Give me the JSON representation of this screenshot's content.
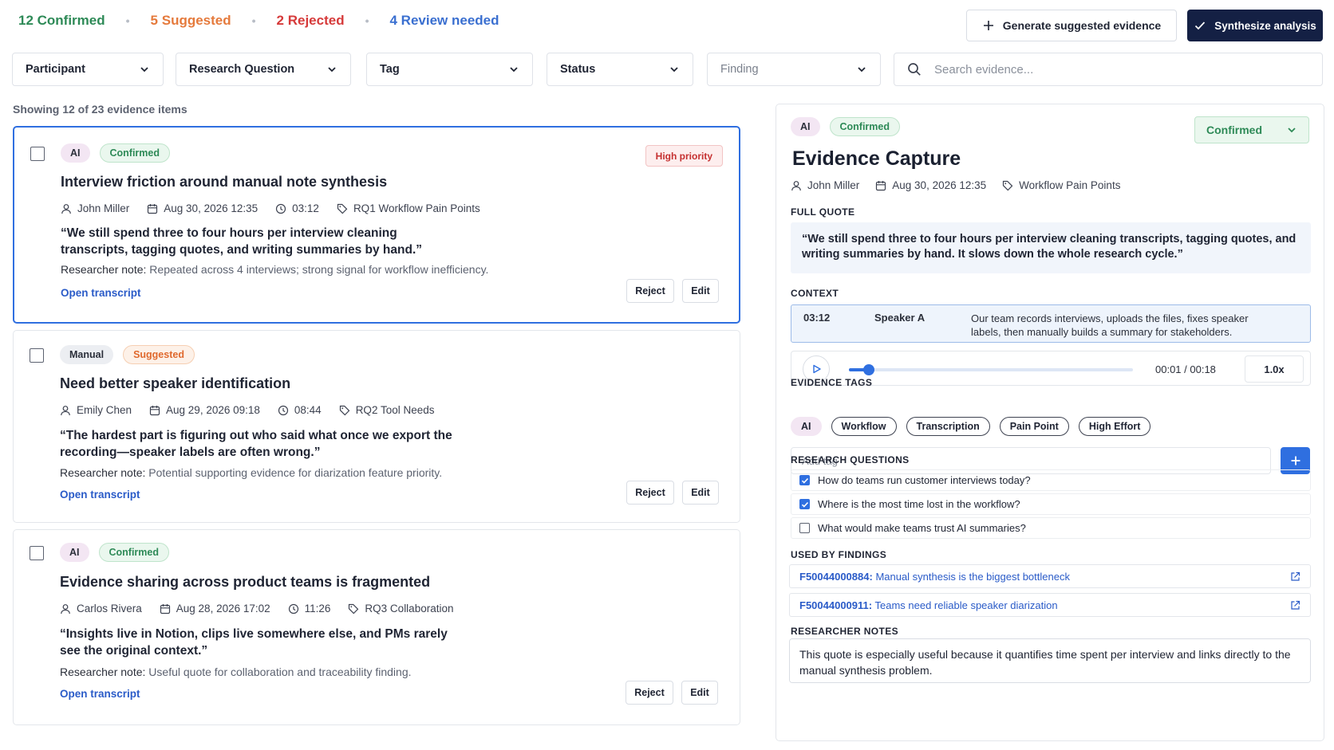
{
  "stats": {
    "confirmed": "12 Confirmed",
    "suggested": "5 Suggested",
    "rejected": "2 Rejected",
    "review": "4 Review needed"
  },
  "actions": {
    "generate": "Generate suggested evidence",
    "synthesize": "Synthesize analysis"
  },
  "filters": {
    "participant": "Participant",
    "research_question": "Research Question",
    "tag": "Tag",
    "status": "Status",
    "finding": "Finding",
    "search_placeholder": "Search evidence..."
  },
  "showing": "Showing 12 of 23 evidence items",
  "cards": [
    {
      "source": "AI",
      "status": "Confirmed",
      "priority": "High priority",
      "title": "Interview friction around manual note synthesis",
      "participant": "John Miller",
      "date": "Aug 30, 2026 12:35",
      "time": "03:12",
      "tag": "RQ1 Workflow Pain Points",
      "quote": "“We still spend three to four hours per interview cleaning transcripts, tagging quotes, and writing summaries by hand.”",
      "note_label": "Researcher note:",
      "note": "Repeated across 4 interviews; strong signal for workflow inefficiency.",
      "open": "Open transcript",
      "reject": "Reject",
      "edit": "Edit"
    },
    {
      "source": "Manual",
      "status": "Suggested",
      "title": "Need better speaker identification",
      "participant": "Emily Chen",
      "date": "Aug 29, 2026 09:18",
      "time": "08:44",
      "tag": "RQ2 Tool Needs",
      "quote": "“The hardest part is figuring out who said what once we export the recording—speaker labels are often wrong.”",
      "note_label": "Researcher note:",
      "note": "Potential supporting evidence for diarization feature priority.",
      "open": "Open transcript",
      "reject": "Reject",
      "edit": "Edit"
    },
    {
      "source": "AI",
      "status": "Confirmed",
      "title": "Evidence sharing across product teams is fragmented",
      "participant": "Carlos Rivera",
      "date": "Aug 28, 2026 17:02",
      "time": "11:26",
      "tag": "RQ3 Collaboration",
      "quote": "“Insights live in Notion, clips live somewhere else, and PMs rarely see the original context.”",
      "note_label": "Researcher note:",
      "note": "Useful quote for collaboration and traceability finding.",
      "open": "Open transcript",
      "reject": "Reject",
      "edit": "Edit"
    }
  ],
  "detail": {
    "source": "AI",
    "status_pill": "Confirmed",
    "status_select": "Confirmed",
    "title": "Evidence Capture",
    "participant": "John Miller",
    "date": "Aug 30, 2026 12:35",
    "tag": "Workflow Pain Points",
    "full_quote_label": "FULL QUOTE",
    "full_quote": "“We still spend three to four hours per interview cleaning transcripts, tagging quotes, and writing summaries by hand. It slows down the whole research cycle.”",
    "context_label": "CONTEXT",
    "context_time": "03:12",
    "context_speaker": "Speaker A",
    "context_text": "Our team records interviews, uploads the files, fixes speaker labels, then manually builds a summary for stakeholders.",
    "player_time": "00:01 / 00:18",
    "player_progress": 0.07,
    "speed": "1.0x",
    "tags_label": "EVIDENCE TAGS",
    "tags": [
      "AI",
      "Workflow",
      "Transcription",
      "Pain Point",
      "High Effort"
    ],
    "add_tag_placeholder": "Add tag",
    "rq_label": "RESEARCH QUESTIONS",
    "research_questions": [
      {
        "text": "How do teams run customer interviews today?",
        "checked": true
      },
      {
        "text": "Where is the most time lost in the workflow?",
        "checked": true
      },
      {
        "text": "What would make teams trust AI summaries?",
        "checked": false
      }
    ],
    "findings_label": "USED BY FINDINGS",
    "findings": [
      {
        "id": "F50044000884:",
        "text": "Manual synthesis is the biggest bottleneck"
      },
      {
        "id": "F50044000911:",
        "text": "Teams need reliable speaker diarization"
      }
    ],
    "notes_label": "RESEARCHER NOTES",
    "notes": "This quote is especially useful because it quantifies time spent per interview and links directly to the manual synthesis problem."
  },
  "colors": {
    "accent": "#2f6fe0",
    "dark_button": "#142044",
    "confirmed": "#2e8a57",
    "suggested": "#e57a3c",
    "rejected": "#d63a3a"
  }
}
